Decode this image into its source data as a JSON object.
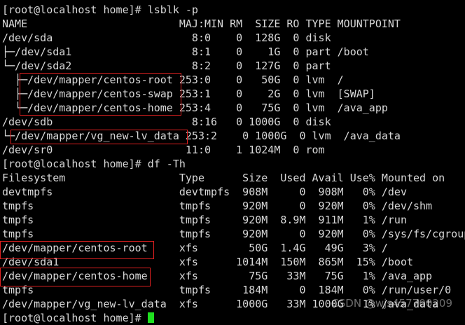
{
  "terminal": {
    "lines": [
      "[root@localhost home]# lsblk -p",
      "NAME                        MAJ:MIN RM  SIZE RO TYPE MOUNTPOINT",
      "/dev/sda                      8:0    0  128G  0 disk",
      "├─/dev/sda1                   8:1    0    1G  0 part /boot",
      "└─/dev/sda2                   8:2    0  127G  0 part",
      "  ├─/dev/mapper/centos-root 253:0    0   50G  0 lvm  /",
      "  ├─/dev/mapper/centos-swap 253:1    0    2G  0 lvm  [SWAP]",
      "  └─/dev/mapper/centos-home 253:4    0   75G  0 lvm  /ava_app",
      "/dev/sdb                      8:16   0 1000G  0 disk",
      "└─/dev/mapper/vg_new-lv_data 253:2    0 1000G  0 lvm  /ava_data",
      "/dev/sr0                     11:0    1 1024M  0 rom",
      "[root@localhost home]# df -Th",
      "Filesystem                  Type      Size  Used Avail Use% Mounted on",
      "devtmpfs                    devtmpfs  908M     0  908M   0% /dev",
      "tmpfs                       tmpfs     920M     0  920M   0% /dev/shm",
      "tmpfs                       tmpfs     920M  8.9M  911M   1% /run",
      "tmpfs                       tmpfs     920M     0  920M   0% /sys/fs/cgroup",
      "/dev/mapper/centos-root     xfs        50G  1.4G   49G   3% /",
      "/dev/sda1                   xfs      1014M  150M  865M  15% /boot",
      "/dev/mapper/centos-home     xfs        75G   33M   75G   1% /ava_app",
      "tmpfs                       tmpfs     184M     0  184M   0% /run/user/0",
      "/dev/mapper/vg_new-lv_data  xfs      1000G   33M 1000G   1% /ava_data"
    ],
    "prompt": "[root@localhost home]# ",
    "watermark": "CSDN @wjs457700209",
    "colors": {
      "background": "#000000",
      "text": "#d8d8d8",
      "highlight": "#e02020",
      "cursor": "#1fe01f"
    }
  }
}
